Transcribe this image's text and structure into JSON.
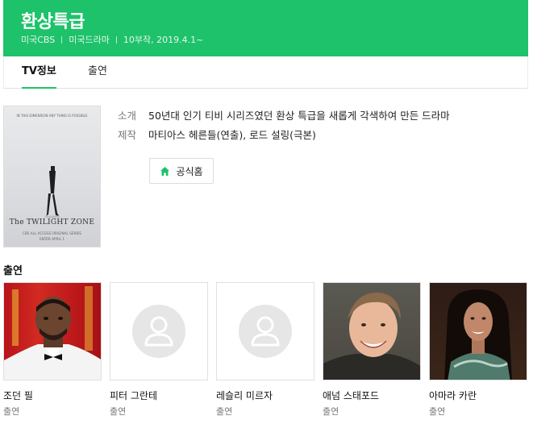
{
  "header": {
    "title": "환상특급",
    "meta": [
      "미국CBS",
      "미국드라마",
      "10부작, 2019.4.1~"
    ],
    "bg_color": "#1ec26a"
  },
  "tabs": [
    {
      "label": "TV정보",
      "active": true
    },
    {
      "label": "출연",
      "active": false
    }
  ],
  "poster": {
    "top_text": "IN THIS DIMENSION ANY THING IS POSSIBLE",
    "logo_text": "The TWILIGHT ZONE",
    "bottom_text": "CBS ALL ACCESS ORIGINAL SERIES",
    "bottom_text2": "ENTER APRIL 1"
  },
  "info": [
    {
      "key": "소개",
      "value": "50년대 인기 티비 시리즈였던 환상 특급을 새롭게 각색하여 만든 드라마"
    },
    {
      "key": "제작",
      "value": "마티아스 헤른들(연출), 로드 설링(극본)"
    }
  ],
  "official_button": {
    "label": "공식홈",
    "icon": "home-icon"
  },
  "cast_section": {
    "title": "출연",
    "members": [
      {
        "name": "조던 필",
        "role": "출연",
        "photo": "photo"
      },
      {
        "name": "피터 그란테",
        "role": "출연",
        "photo": "placeholder"
      },
      {
        "name": "레슬리 미르자",
        "role": "출연",
        "photo": "placeholder"
      },
      {
        "name": "애넘 스태포드",
        "role": "출연",
        "photo": "photo"
      },
      {
        "name": "아마라 카란",
        "role": "출연",
        "photo": "photo"
      }
    ]
  }
}
